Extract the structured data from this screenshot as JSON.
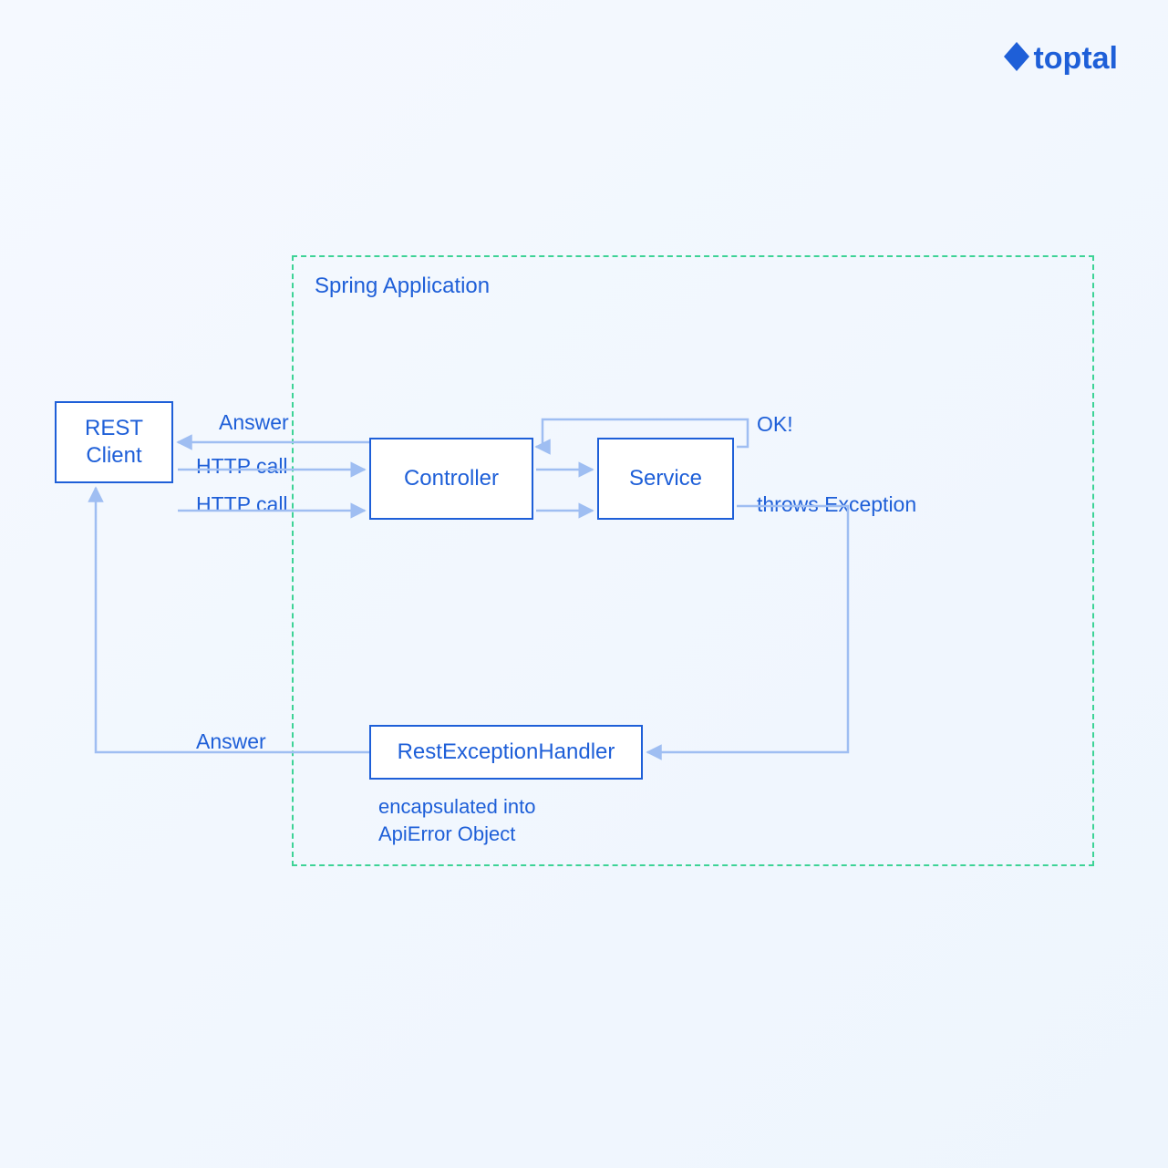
{
  "brand": "toptal",
  "container": {
    "title": "Spring Application"
  },
  "boxes": {
    "rest_client": "REST Client",
    "controller": "Controller",
    "service": "Service",
    "handler": "RestExceptionHandler"
  },
  "edges": {
    "answer_top": "Answer",
    "http_call_1": "HTTP call",
    "http_call_2": "HTTP call",
    "ok": "OK!",
    "throws": "throws Exception",
    "answer_bottom": "Answer",
    "encapsulated": "encapsulated into\nApiError Object"
  },
  "colors": {
    "blue": "#1e5fd8",
    "light_blue_stroke": "#9fbef2",
    "green_dash": "#3dd396"
  }
}
